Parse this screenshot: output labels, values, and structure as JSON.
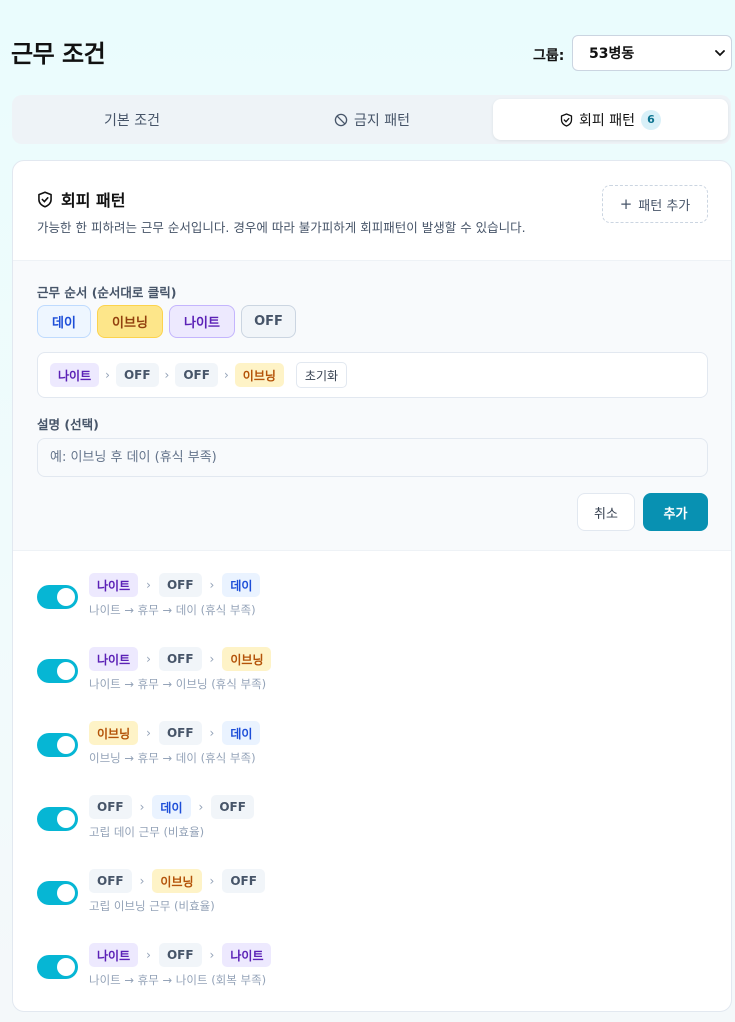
{
  "header": {
    "title": "근무 조건",
    "group_label": "그룹:",
    "group_value": "53병동"
  },
  "tabs": [
    {
      "label": "기본 조건",
      "icon": "",
      "active": false
    },
    {
      "label": "금지 패턴",
      "icon": "ban-icon",
      "active": false
    },
    {
      "label": "회피 패턴",
      "icon": "shield-icon",
      "active": true,
      "count": "6"
    }
  ],
  "card": {
    "title": "회피 패턴",
    "description": "가능한 한 피하려는 근무 순서입니다. 경우에 따라 불가피하게 회피패턴이 발생할 수 있습니다.",
    "add_button": "패턴 추가"
  },
  "form": {
    "sequence_label": "근무 순서 (순서대로 클릭)",
    "shift_buttons": [
      "데이",
      "이브닝",
      "나이트",
      "OFF"
    ],
    "current_sequence": [
      "나이트",
      "OFF",
      "OFF",
      "이브닝"
    ],
    "reset_label": "초기화",
    "description_label": "설명 (선택)",
    "description_placeholder": "예: 이브닝 후 데이 (휴식 부족)",
    "cancel_label": "취소",
    "submit_label": "추가"
  },
  "patterns": [
    {
      "enabled": true,
      "sequence": [
        "나이트",
        "OFF",
        "데이"
      ],
      "description": "나이트 → 휴무 → 데이 (휴식 부족)"
    },
    {
      "enabled": true,
      "sequence": [
        "나이트",
        "OFF",
        "이브닝"
      ],
      "description": "나이트 → 휴무 → 이브닝 (휴식 부족)"
    },
    {
      "enabled": true,
      "sequence": [
        "이브닝",
        "OFF",
        "데이"
      ],
      "description": "이브닝 → 휴무 → 데이 (휴식 부족)"
    },
    {
      "enabled": true,
      "sequence": [
        "OFF",
        "데이",
        "OFF"
      ],
      "description": "고립 데이 근무 (비효율)"
    },
    {
      "enabled": true,
      "sequence": [
        "OFF",
        "이브닝",
        "OFF"
      ],
      "description": "고립 이브닝 근무 (비효율)"
    },
    {
      "enabled": true,
      "sequence": [
        "나이트",
        "OFF",
        "나이트"
      ],
      "description": "나이트 → 휴무 → 나이트 (회복 부족)"
    }
  ],
  "colors": {
    "accent": "#0891b2",
    "toggle_on": "#06b6d4",
    "day": "#1d4ed8",
    "evening": "#b45309",
    "night": "#5b21b6",
    "off": "#475569"
  }
}
